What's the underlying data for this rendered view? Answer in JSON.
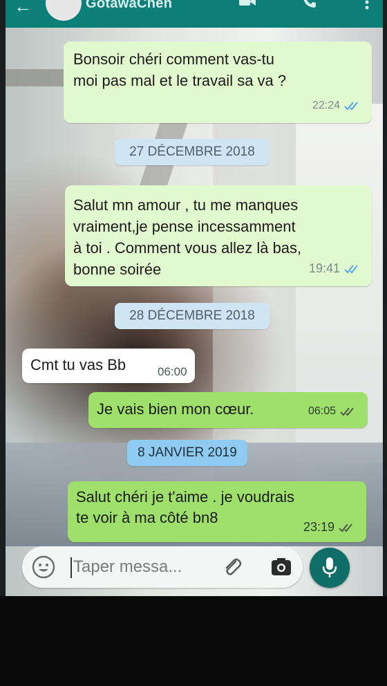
{
  "header": {
    "title": "GotawaChen"
  },
  "messages": [
    {
      "text": "Bonsoir chéri comment vas-tu\nmoi pas mal et le travail sa va ?",
      "time": "22:24",
      "direction": "outgoing",
      "status": "read"
    },
    {
      "text": "Salut mn amour , tu me manques\nvraiment,je pense incessamment\nà toi . Comment vous allez là bas,\nbonne soirée",
      "time": "19:41",
      "direction": "outgoing",
      "status": "read"
    },
    {
      "text": "Cmt tu vas Bb",
      "time": "06:00",
      "direction": "incoming"
    },
    {
      "text": "Je vais bien mon cœur.",
      "time": "06:05",
      "direction": "outgoing",
      "status": "read"
    },
    {
      "text": "Salut chéri je t'aime . je voudrais\nte voir à ma côté bn8",
      "time": "23:19",
      "direction": "outgoing",
      "status": "read"
    }
  ],
  "dates": [
    "27 DÉCEMBRE 2018",
    "28 DÉCEMBRE 2018",
    "8 JANVIER 2019"
  ],
  "composer": {
    "placeholder": "Taper messa..."
  },
  "icons": {
    "back": "arrow-left-icon",
    "video": "video-camera-icon",
    "call": "phone-icon",
    "menu": "more-vert-icon",
    "emoji": "emoji-icon",
    "attach": "paperclip-icon",
    "camera": "camera-icon",
    "mic": "microphone-icon",
    "ticks": "double-check-icon"
  },
  "colors": {
    "header": "#0f8079",
    "outgoing_bubble": "#e2f8ce",
    "read_ticks": "#4fa9e8",
    "mic_button": "#0f6e68"
  }
}
